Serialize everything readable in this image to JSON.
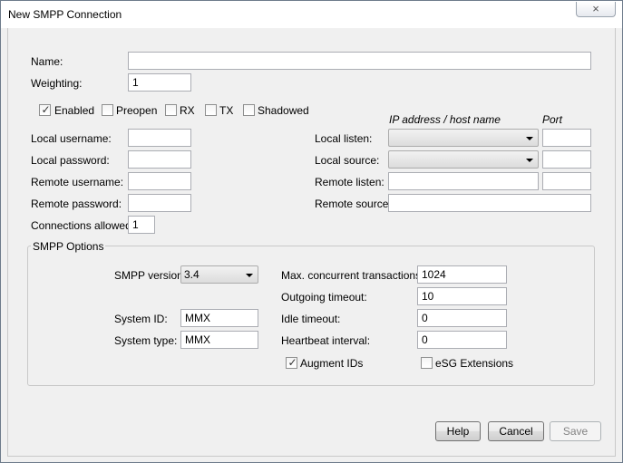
{
  "window": {
    "title": "New SMPP Connection"
  },
  "fields": {
    "name": {
      "label": "Name:",
      "value": ""
    },
    "weighting": {
      "label": "Weighting:",
      "value": "1"
    },
    "local_username": {
      "label": "Local username:",
      "value": ""
    },
    "local_password": {
      "label": "Local password:",
      "value": ""
    },
    "remote_username": {
      "label": "Remote username:",
      "value": ""
    },
    "remote_password": {
      "label": "Remote password:",
      "value": ""
    },
    "connections_allowed": {
      "label": "Connections allowed:",
      "value": "1"
    }
  },
  "flags": [
    {
      "label": "Enabled",
      "checked": true
    },
    {
      "label": "Preopen",
      "checked": false
    },
    {
      "label": "RX",
      "checked": false
    },
    {
      "label": "TX",
      "checked": false
    },
    {
      "label": "Shadowed",
      "checked": false
    }
  ],
  "network": {
    "ip_header": "IP address / host name",
    "port_header": "Port",
    "local_listen_label": "Local listen:",
    "local_source_label": "Local source:",
    "remote_listen_label": "Remote listen:",
    "remote_source_label": "Remote source:",
    "local_listen_ip": "",
    "local_listen_port": "",
    "local_source_ip": "",
    "local_source_port": "",
    "remote_listen_ip": "",
    "remote_listen_port": "",
    "remote_source_ip": ""
  },
  "smpp": {
    "group_title": "SMPP Options",
    "version_label": "SMPP version:",
    "version_value": "3.4",
    "system_id_label": "System ID:",
    "system_id_value": "MMX",
    "system_type_label": "System type:",
    "system_type_value": "MMX",
    "max_concurrent_label": "Max. concurrent transactions:",
    "max_concurrent_value": "1024",
    "outgoing_timeout_label": "Outgoing timeout:",
    "outgoing_timeout_value": "10",
    "idle_timeout_label": "Idle timeout:",
    "idle_timeout_value": "0",
    "heartbeat_label": "Heartbeat interval:",
    "heartbeat_value": "0",
    "augment_ids_label": "Augment IDs",
    "augment_ids_checked": true,
    "esg_extensions_label": "eSG Extensions",
    "esg_extensions_checked": false
  },
  "buttons": {
    "help": "Help",
    "cancel": "Cancel",
    "save": "Save",
    "close_glyph": "×"
  }
}
